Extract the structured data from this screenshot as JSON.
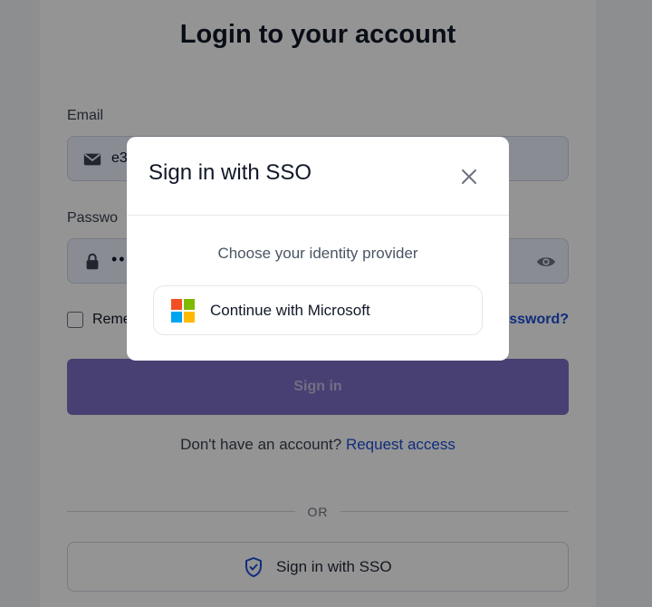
{
  "page": {
    "title": "Login to your account",
    "email": {
      "label": "Email",
      "value": "e3",
      "icon": "envelope-icon"
    },
    "password": {
      "label": "Passwo",
      "value": "••",
      "icon": "lock-icon",
      "toggle_icon": "eye-icon"
    },
    "remember_label": "Reme",
    "forgot_label": "ssword?",
    "signin_label": "Sign in",
    "no_account_text": "Don't have an account?",
    "request_access_label": "Request access",
    "or_text": "OR",
    "sso_button_label": "Sign in with SSO",
    "sso_icon": "shield-check-icon"
  },
  "modal": {
    "title": "Sign in with SSO",
    "close_icon": "close-icon",
    "subtitle": "Choose your identity provider",
    "provider_button_label": "Continue with Microsoft",
    "provider_icon": "microsoft-logo-icon"
  },
  "colors": {
    "primary_button": "#7c6fc4",
    "link": "#1d4ed8",
    "shield": "#1d4ed8",
    "ms_red": "#f25022",
    "ms_green": "#7fba00",
    "ms_blue": "#00a4ef",
    "ms_yellow": "#ffb900"
  }
}
